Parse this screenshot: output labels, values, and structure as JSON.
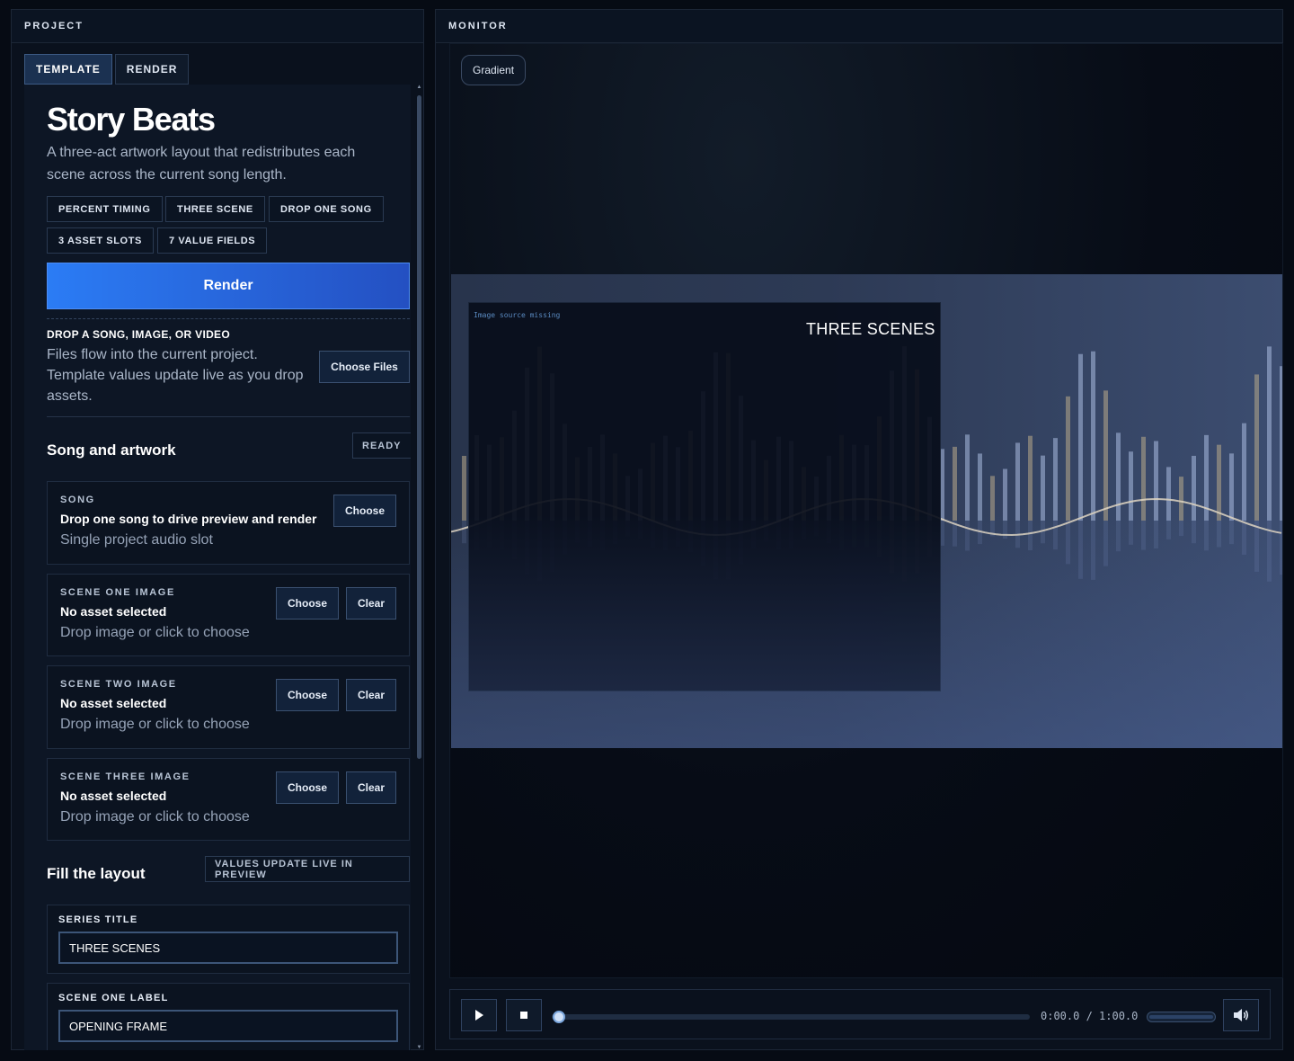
{
  "project": {
    "header": "PROJECT",
    "tabs": [
      {
        "label": "TEMPLATE",
        "active": true
      },
      {
        "label": "RENDER",
        "active": false
      }
    ],
    "template": {
      "title": "Story Beats",
      "description": "A three-act artwork layout that redistributes each scene across the current song length.",
      "chips": [
        "PERCENT TIMING",
        "THREE SCENE",
        "DROP ONE SONG",
        "3 ASSET SLOTS",
        "7 VALUE FIELDS"
      ]
    },
    "render_button": "Render",
    "drop": {
      "title": "DROP A SONG, IMAGE, OR VIDEO",
      "text": "Files flow into the current project. Template values update live as you drop assets.",
      "button": "Choose Files"
    },
    "assets_section": {
      "title": "Song and artwork",
      "status": "READY"
    },
    "slots": [
      {
        "label": "SONG",
        "value": "Drop one song to drive preview and render",
        "hint": "Single project audio slot",
        "choose": "Choose",
        "clear": null
      },
      {
        "label": "SCENE ONE IMAGE",
        "value": "No asset selected",
        "hint": "Drop image or click to choose",
        "choose": "Choose",
        "clear": "Clear"
      },
      {
        "label": "SCENE TWO IMAGE",
        "value": "No asset selected",
        "hint": "Drop image or click to choose",
        "choose": "Choose",
        "clear": "Clear"
      },
      {
        "label": "SCENE THREE IMAGE",
        "value": "No asset selected",
        "hint": "Drop image or click to choose",
        "choose": "Choose",
        "clear": "Clear"
      }
    ],
    "layout_section": {
      "title": "Fill the layout",
      "badge": "VALUES UPDATE LIVE IN PREVIEW"
    },
    "fields": [
      {
        "label": "SERIES TITLE",
        "value": "THREE SCENES"
      },
      {
        "label": "SCENE ONE LABEL",
        "value": "OPENING FRAME"
      }
    ]
  },
  "monitor": {
    "header": "MONITOR",
    "background_mode": "Gradient",
    "preview": {
      "missing_text": "Image source missing",
      "scene_title": "THREE SCENES"
    },
    "transport": {
      "play_icon": "play-icon",
      "stop_icon": "stop-icon",
      "volume_icon": "speaker-icon",
      "time": "0:00.0 / 1:00.0",
      "progress": 0.0,
      "volume": 1.0
    }
  },
  "colors": {
    "accent": "#2b7cf5",
    "accent_dark": "#2450c2",
    "panel": "#0a111d"
  }
}
